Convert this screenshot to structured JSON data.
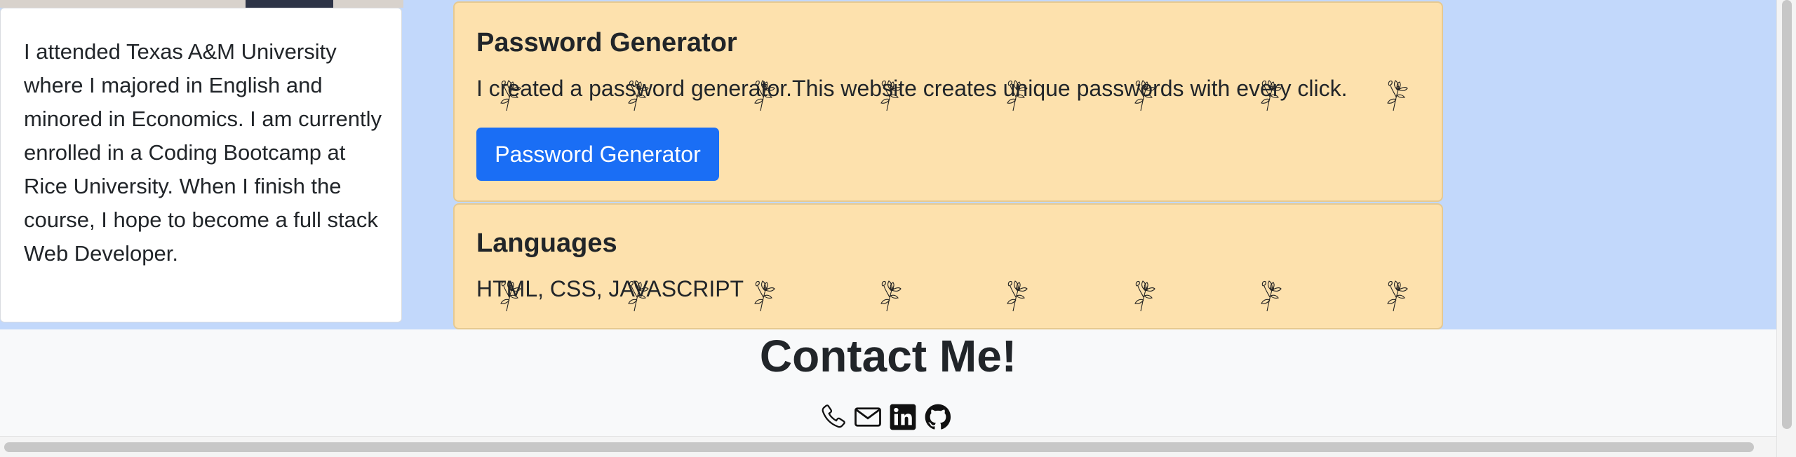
{
  "about": {
    "text": "I attended Texas A&M University where I majored in English and minored in Economics. I am currently enrolled in a Coding Bootcamp at Rice University. When I finish the course, I hope to become a full stack Web Developer."
  },
  "projects": [
    {
      "title": "Password Generator",
      "description": "I created a password generator.This website creates unique passwords with every click.",
      "button_label": "Password Generator"
    },
    {
      "title": "Languages",
      "description": "HTML, CSS, JAVASCRIPT"
    }
  ],
  "footer": {
    "title": "Contact Me!",
    "icons": [
      "phone-icon",
      "email-icon",
      "linkedin-icon",
      "github-icon"
    ]
  },
  "colors": {
    "page_background": "#c2d8fb",
    "card_background": "#fde1ad",
    "button": "#1a6ef5",
    "footer_background": "#f8f9fa"
  }
}
